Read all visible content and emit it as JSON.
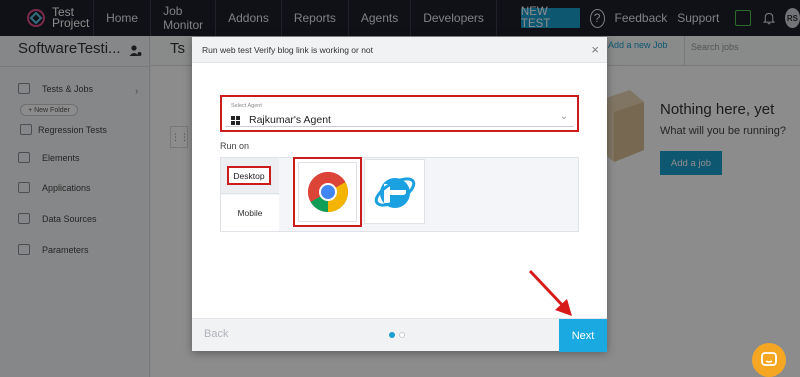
{
  "nav": {
    "logo_line1": "Test",
    "logo_line2": "Project",
    "items": [
      "Home",
      "Job Monitor",
      "Addons",
      "Reports",
      "Agents",
      "Developers"
    ],
    "new_test": "NEW TEST",
    "help": "?",
    "feedback": "Feedback",
    "support": "Support",
    "avatar_initials": "RS"
  },
  "sidebar": {
    "project_title": "SoftwareTesti...",
    "new_folder": "+ New Folder",
    "items": {
      "tests_jobs": "Tests & Jobs",
      "regression": "Regression Tests",
      "elements": "Elements",
      "applications": "Applications",
      "data_sources": "Data Sources",
      "parameters": "Parameters"
    }
  },
  "main": {
    "title_partial": "Ts",
    "add_new_job": "Add a new Job",
    "search_placeholder": "Search jobs",
    "empty_title": "Nothing here, yet",
    "empty_sub": "What will you be running?",
    "add_job": "Add a job"
  },
  "modal": {
    "title": "Run web test Verify blog link is working or not",
    "close": "×",
    "agent_label": "Select Agent",
    "agent_value": "Rajkumar's Agent",
    "run_on": "Run on",
    "tab_desktop": "Desktop",
    "tab_mobile": "Mobile",
    "back": "Back",
    "next": "Next"
  },
  "colors": {
    "accent": "#1a9fce",
    "highlight": "#cc1b1b",
    "nav_bg": "#1c1f2a"
  }
}
